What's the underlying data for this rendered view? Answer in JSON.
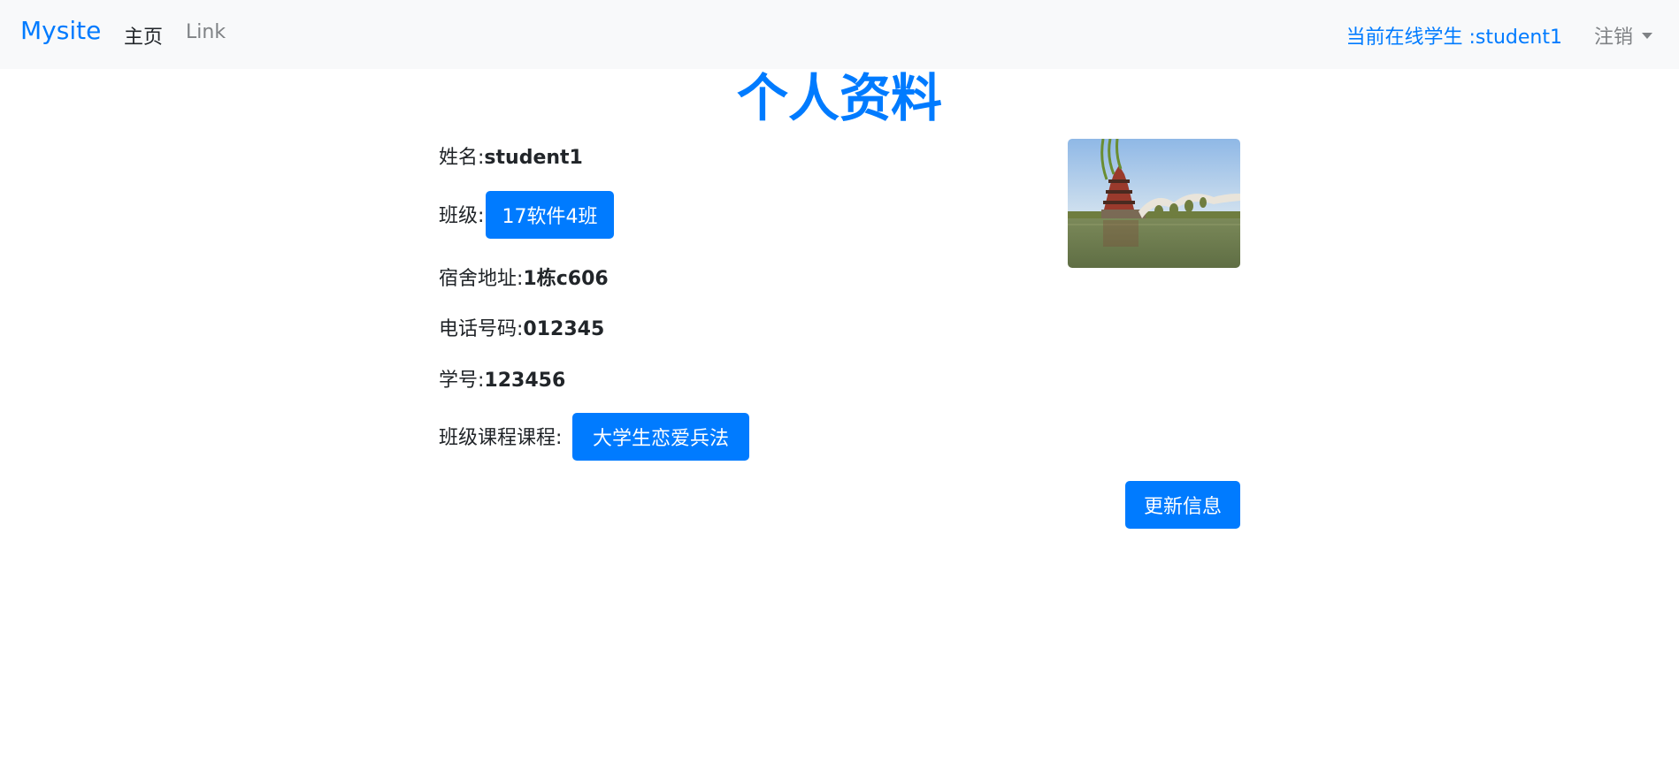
{
  "navbar": {
    "brand": "Mysite",
    "home": "主页",
    "link": "Link",
    "online_user": "当前在线学生 :student1",
    "logout": "注销"
  },
  "title": "个人资料",
  "profile": {
    "name_label": "姓名:",
    "name_value": "student1",
    "class_label": "班级:",
    "class_value": "17软件4班",
    "dorm_label": "宿舍地址:",
    "dorm_value": "1栋c606",
    "phone_label": "电话号码:",
    "phone_value": "012345",
    "id_label": "学号:",
    "id_value": "123456",
    "course_label": "班级课程课程:",
    "course_value": "大学生恋爱兵法"
  },
  "update_button": "更新信息",
  "colors": {
    "primary": "#007bff",
    "navbar_bg": "#f8f9fa",
    "muted": "#7f8285"
  }
}
